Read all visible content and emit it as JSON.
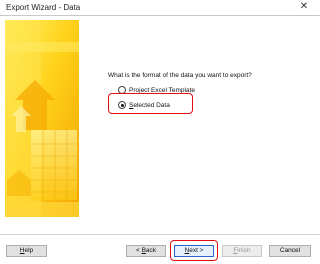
{
  "window": {
    "title": "Export Wizard - Data",
    "close_glyph": "✕"
  },
  "main": {
    "question": "What is the format of the data you want to export?",
    "options": [
      {
        "label_key": "P",
        "label_rest": "roject Excel Template",
        "selected": false
      },
      {
        "label_key": "S",
        "label_rest": "elected Data",
        "selected": true
      }
    ]
  },
  "footer": {
    "help": {
      "key": "H",
      "rest": "elp"
    },
    "back": {
      "prefix": "< ",
      "key": "B",
      "rest": "ack"
    },
    "next": {
      "key": "N",
      "rest": "ext >"
    },
    "finish": {
      "key": "F",
      "rest": "inish"
    },
    "cancel": "Cancel"
  },
  "colors": {
    "highlight": "#e01010",
    "banner_primary": "#ffd21a",
    "banner_secondary": "#f4a400"
  },
  "icons": [
    "close-icon",
    "radio-unchecked-icon",
    "radio-checked-icon"
  ]
}
